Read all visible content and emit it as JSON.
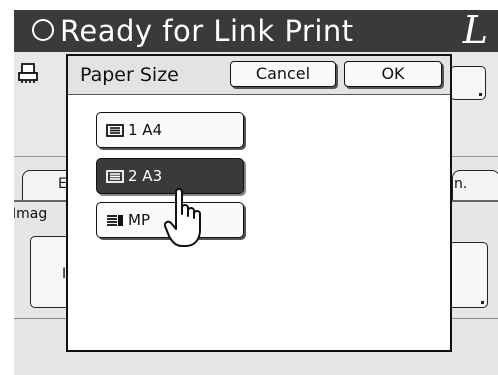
{
  "header": {
    "title": "Ready for Link Print",
    "mode_letter": "L"
  },
  "background": {
    "tab_left_letter": "E",
    "tab_right_text": "n.",
    "image_label": "Imag",
    "left_button_letter": "I"
  },
  "dialog": {
    "title": "Paper Size",
    "cancel_label": "Cancel",
    "ok_label": "OK",
    "options": [
      {
        "label": "1  A4",
        "icon": "paper-tray-icon",
        "selected": false
      },
      {
        "label": "2  A3",
        "icon": "paper-tray-icon",
        "selected": true
      },
      {
        "label": "MP",
        "icon": "manual-feed-tray-icon",
        "selected": false
      }
    ]
  },
  "colors": {
    "title_bar": "#3a3a3a",
    "selected_button": "#3a3a3a",
    "dialog_header": "#e3e3e3"
  }
}
